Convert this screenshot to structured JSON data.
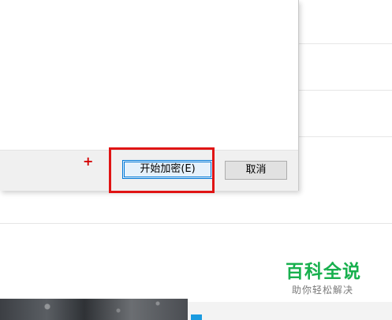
{
  "dialog": {
    "start_button_label": "开始加密(E)",
    "cancel_button_label": "取消",
    "cursor_glyph": "+"
  },
  "watermark": {
    "title": "百科全说",
    "subtitle": "助你轻松解决"
  },
  "colors": {
    "highlight": "#e01414",
    "cursor": "#d40000",
    "watermark_green": "#18b04e",
    "button_focus": "#0078d7"
  }
}
